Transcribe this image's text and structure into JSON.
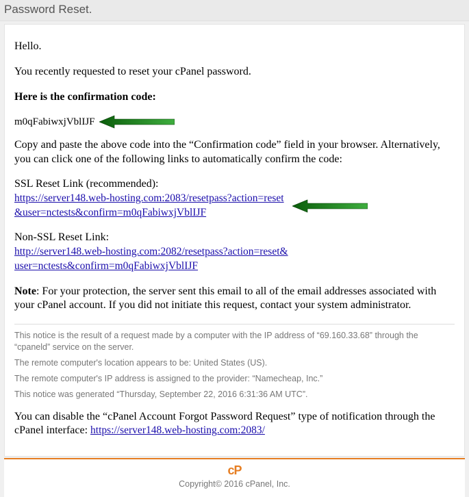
{
  "header": {
    "title": "Password Reset."
  },
  "body": {
    "greeting": "Hello.",
    "intro": "You recently requested to reset your cPanel password.",
    "code_heading": "Here is the confirmation code:",
    "code": "m0qFabiwxjVblIJF",
    "instructions": "Copy and paste the above code into the “Confirmation code” field in your browser. Alternatively, you can click one of the following links to automatically confirm the code:",
    "ssl_label": "SSL Reset Link (recommended):",
    "ssl_link": "https://server148.web-hosting.com:2083/resetpass?action=reset&user=nctests&confirm=m0qFabiwxjVblIJF",
    "nonssl_label": "Non-SSL Reset Link:",
    "nonssl_link": "http://server148.web-hosting.com:2082/resetpass?action=reset&user=nctests&confirm=m0qFabiwxjVblIJF",
    "note_prefix": "Note",
    "note_body": ": For your protection, the server sent this email to all of the email addresses associated with your cPanel account. If you did not initiate this request, contact your system administrator.",
    "notices": [
      "This notice is the result of a request made by a computer with the IP address of “69.160.33.68” through the “cpaneld” service on the server.",
      "The remote computer's location appears to be: United States (US).",
      "The remote computer's IP address is assigned to the provider: “Namecheap, Inc.”",
      "This notice was generated “Thursday, September 22, 2016 6:31:36 AM UTC”."
    ],
    "disable_prefix": "You can disable the “cPanel Account Forgot Password Request” type of notification through the cPanel interface: ",
    "disable_link": "https://server148.web-hosting.com:2083/"
  },
  "footer": {
    "logo_text": "cP",
    "copyright": "Copyright© 2016 cPanel, Inc."
  }
}
